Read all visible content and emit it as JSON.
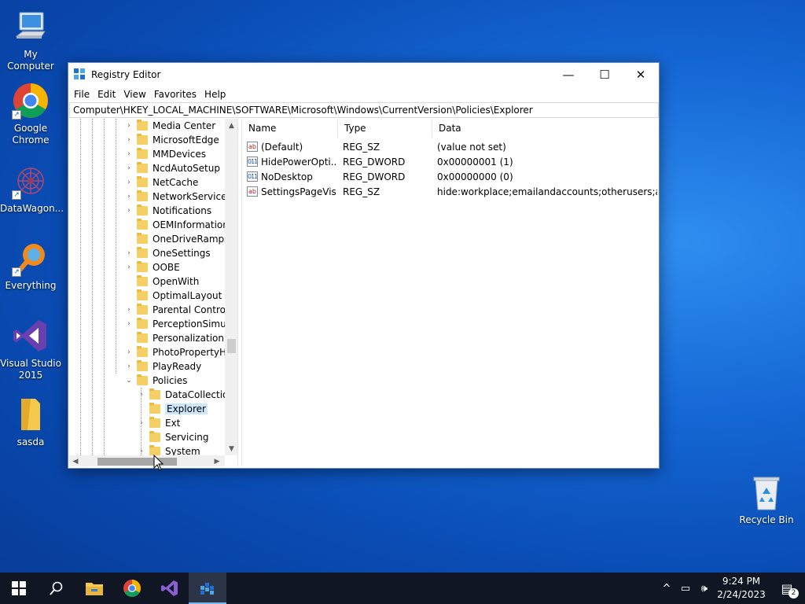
{
  "desktop": {
    "icons": [
      {
        "label": "My Computer",
        "icon": "computer-icon"
      },
      {
        "label": "Google Chrome",
        "icon": "chrome-icon"
      },
      {
        "label": "DataWagon...",
        "icon": "datawagon-icon"
      },
      {
        "label": "Everything",
        "icon": "everything-search-icon"
      },
      {
        "label": "Visual Studio 2015",
        "icon": "visual-studio-icon"
      },
      {
        "label": "sasda",
        "icon": "folder-icon"
      },
      {
        "label": "Recycle Bin",
        "icon": "recycle-bin-icon"
      }
    ]
  },
  "window": {
    "title": "Registry Editor",
    "minimize_glyph": "—",
    "maximize_glyph": "☐",
    "close_glyph": "✕",
    "menu": [
      "File",
      "Edit",
      "View",
      "Favorites",
      "Help"
    ],
    "address": "Computer\\HKEY_LOCAL_MACHINE\\SOFTWARE\\Microsoft\\Windows\\CurrentVersion\\Policies\\Explorer"
  },
  "tree": {
    "items": [
      {
        "label": "Media Center",
        "expander": "›"
      },
      {
        "label": "MicrosoftEdge",
        "expander": "›"
      },
      {
        "label": "MMDevices",
        "expander": "›"
      },
      {
        "label": "NcdAutoSetup",
        "expander": "›"
      },
      {
        "label": "NetCache",
        "expander": "›"
      },
      {
        "label": "NetworkServiceTr",
        "expander": "›"
      },
      {
        "label": "Notifications",
        "expander": "›"
      },
      {
        "label": "OEMInformation",
        "expander": ""
      },
      {
        "label": "OneDriveRamps",
        "expander": ""
      },
      {
        "label": "OneSettings",
        "expander": "›"
      },
      {
        "label": "OOBE",
        "expander": "›"
      },
      {
        "label": "OpenWith",
        "expander": ""
      },
      {
        "label": "OptimalLayout",
        "expander": ""
      },
      {
        "label": "Parental Controls",
        "expander": "›"
      },
      {
        "label": "PerceptionSimula",
        "expander": "›"
      },
      {
        "label": "Personalization",
        "expander": ""
      },
      {
        "label": "PhotoPropertyHa",
        "expander": "›"
      },
      {
        "label": "PlayReady",
        "expander": "›"
      },
      {
        "label": "Policies",
        "expander": "⌄"
      },
      {
        "label": "DataCollection",
        "expander": "›"
      },
      {
        "label": "Explorer",
        "expander": ""
      },
      {
        "label": "Ext",
        "expander": "›"
      },
      {
        "label": "Servicing",
        "expander": ""
      },
      {
        "label": "System",
        "expander": "›"
      }
    ],
    "scroll_up": "▲",
    "scroll_down": "▼",
    "scroll_left": "◀",
    "scroll_right": "▶"
  },
  "list": {
    "columns": [
      "Name",
      "Type",
      "Data"
    ],
    "rows": [
      {
        "name": "(Default)",
        "type": "REG_SZ",
        "data": "(value not set)",
        "icon": "string-value-icon",
        "glyph": "ab"
      },
      {
        "name": "HidePowerOpti...",
        "type": "REG_DWORD",
        "data": "0x00000001 (1)",
        "icon": "dword-value-icon",
        "glyph": "011"
      },
      {
        "name": "NoDesktop",
        "type": "REG_DWORD",
        "data": "0x00000000 (0)",
        "icon": "dword-value-icon",
        "glyph": "011"
      },
      {
        "name": "SettingsPageVisi...",
        "type": "REG_SZ",
        "data": "hide:workplace;emailandaccounts;otherusers;assig...",
        "icon": "string-value-icon",
        "glyph": "ab"
      }
    ]
  },
  "taskbar": {
    "items": [
      "start-icon",
      "search-icon",
      "file-explorer-icon",
      "chrome-icon",
      "visual-studio-icon",
      "registry-editor-icon"
    ],
    "active": "registry-editor-icon",
    "time": "9:24 PM",
    "date": "2/24/2023",
    "notification_count": "2",
    "tray_glyphs": {
      "chevron": "^",
      "network": "▭",
      "volume": "🕪",
      "notifications": "▤"
    }
  },
  "colors": {
    "selection": "#cce8ff",
    "taskbar_accent": "#76b9ed",
    "desktop": "#1466d4"
  }
}
